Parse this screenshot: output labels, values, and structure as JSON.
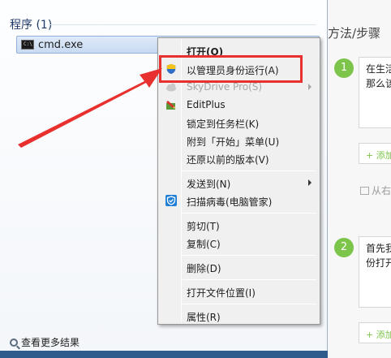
{
  "start_menu": {
    "section_header": "程序 (1)",
    "result": {
      "label": "cmd.exe",
      "icon": "cmd-console-icon",
      "icon_text": "C:\\"
    },
    "more_results": "查看更多结果"
  },
  "context_menu": {
    "items": [
      {
        "label": "打开(O)",
        "bold": true
      },
      {
        "label": "以管理员身份运行(A)",
        "icon": "uac-shield-icon",
        "highlighted": true
      },
      {
        "label": "SkyDrive Pro(S)",
        "disabled": true,
        "submenu": true,
        "icon": "cloud-icon"
      },
      {
        "label": "EditPlus",
        "icon": "editplus-icon"
      },
      {
        "label": "锁定到任务栏(K)"
      },
      {
        "label": "附到「开始」菜单(U)"
      },
      {
        "label": "还原以前的版本(V)"
      },
      {
        "label": "发送到(N)",
        "submenu": true
      },
      {
        "label": "扫描病毒(电脑管家)",
        "icon": "shield-check-icon"
      },
      {
        "label": "剪切(T)"
      },
      {
        "label": "复制(C)"
      },
      {
        "label": "删除(D)"
      },
      {
        "label": "打开文件位置(I)"
      },
      {
        "label": "属性(R)"
      }
    ]
  },
  "article": {
    "title": "方法/步骤",
    "steps": [
      {
        "number": "1",
        "text_line1": "在生活",
        "text_line2": "那么该"
      },
      {
        "number": "2",
        "text_line1": "首先我",
        "text_line2": "份打开"
      }
    ],
    "add_label": "+ 添加",
    "from_label": "从右"
  },
  "colors": {
    "highlight": "#e8312f",
    "accent_green": "#7dc44a",
    "menu_bg": "#f0f0f0"
  }
}
